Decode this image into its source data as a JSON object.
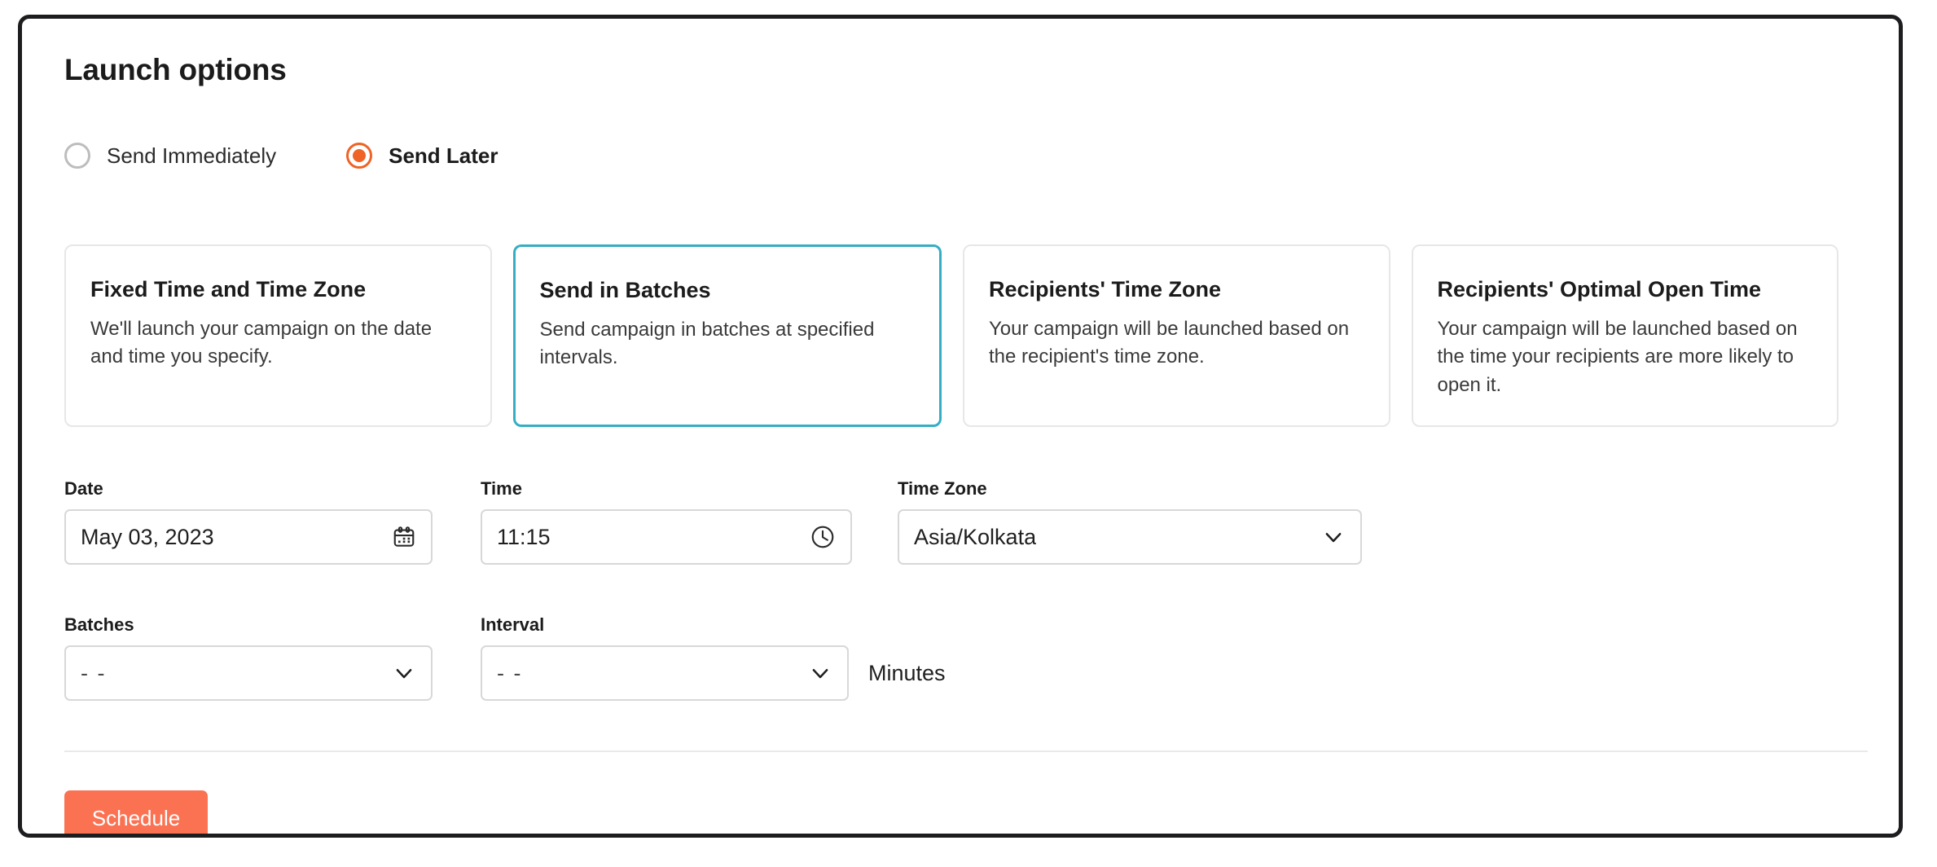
{
  "page": {
    "title": "Launch options"
  },
  "launch_mode": {
    "options": [
      {
        "label": "Send Immediately",
        "selected": false
      },
      {
        "label": "Send Later",
        "selected": true
      }
    ],
    "selected_color": "#ef6326"
  },
  "schedule_cards": {
    "selected_index": 1,
    "selected_border_color": "#35aec4",
    "items": [
      {
        "title": "Fixed Time and Time Zone",
        "description": "We'll launch your campaign on the date and time you specify."
      },
      {
        "title": "Send in Batches",
        "description": "Send campaign in batches at specified intervals."
      },
      {
        "title": "Recipients' Time Zone",
        "description": "Your campaign will be launched based on the recipient's time zone."
      },
      {
        "title": "Recipients' Optimal Open Time",
        "description": "Your campaign will be launched based on the time your recipients are more likely to open it."
      }
    ]
  },
  "form": {
    "date": {
      "label": "Date",
      "value": "May 03, 2023",
      "icon": "calendar-icon"
    },
    "time": {
      "label": "Time",
      "value": "11:15",
      "icon": "clock-icon"
    },
    "timezone": {
      "label": "Time Zone",
      "value": "Asia/Kolkata",
      "icon": "chevron-down-icon"
    },
    "batches": {
      "label": "Batches",
      "value": "- -",
      "icon": "chevron-down-icon"
    },
    "interval": {
      "label": "Interval",
      "value": "- -",
      "icon": "chevron-down-icon",
      "unit": "Minutes"
    }
  },
  "footer": {
    "schedule_label": "Schedule",
    "schedule_color": "#fb7253"
  }
}
